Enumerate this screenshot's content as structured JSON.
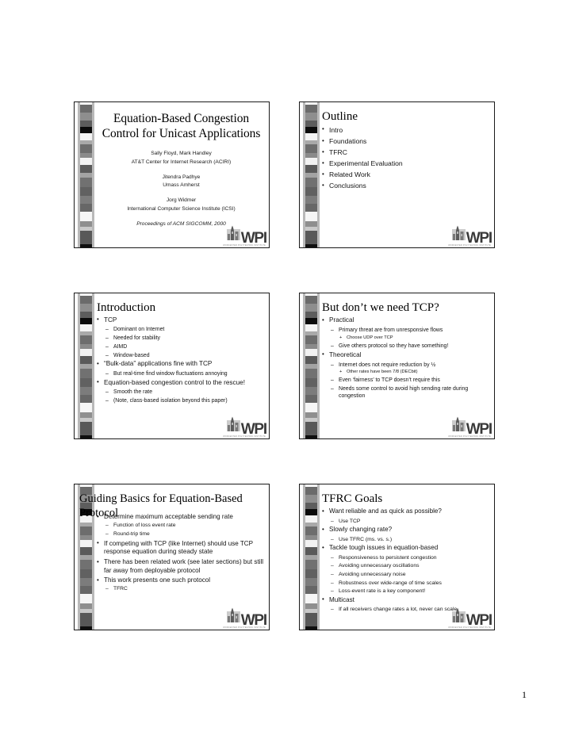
{
  "document": {
    "page_number": "1",
    "logo": {
      "mark": "WPI",
      "tagline": "WORCESTER POLYTECHNIC INSTITUTE",
      "icon": "wpi-tower-icon"
    }
  },
  "slides": [
    {
      "id": "slide-title",
      "title_line1": "Equation-Based Congestion",
      "title_line2": "Control for Unicast Applications",
      "authors": [
        {
          "name": "Sally Floyd, Mark Handley",
          "affiliation": "AT&T Center for Internet Research (ACIRI)"
        },
        {
          "name": "Jitendra Padhye",
          "affiliation": "Umass Amherst"
        },
        {
          "name": "Jorg Widmer",
          "affiliation": "International Computer Science Institute (ICSI)"
        }
      ],
      "proceedings": "Proceedings of ACM SIGCOMM, 2000"
    },
    {
      "id": "slide-outline",
      "title": "Outline",
      "bullets": [
        {
          "level": 1,
          "text": "Intro"
        },
        {
          "level": 1,
          "text": "Foundations"
        },
        {
          "level": 1,
          "text": "TFRC"
        },
        {
          "level": 1,
          "text": "Experimental Evaluation"
        },
        {
          "level": 1,
          "text": "Related Work"
        },
        {
          "level": 1,
          "text": "Conclusions"
        }
      ]
    },
    {
      "id": "slide-introduction",
      "title": "Introduction",
      "bullets": [
        {
          "level": 1,
          "text": "TCP"
        },
        {
          "level": 2,
          "text": "Dominant on Internet"
        },
        {
          "level": 2,
          "text": "Needed for stability"
        },
        {
          "level": 2,
          "text": "AIMD"
        },
        {
          "level": 2,
          "text": "Window-based"
        },
        {
          "level": 1,
          "text": "“Bulk-data” applications fine with TCP"
        },
        {
          "level": 2,
          "text": "But real-time find window fluctuations annoying"
        },
        {
          "level": 1,
          "text": "Equation-based congestion control to the rescue!"
        },
        {
          "level": 2,
          "text": "Smooth the rate"
        },
        {
          "level": 2,
          "text": "(Note, class-based isolation beyond this paper)"
        }
      ]
    },
    {
      "id": "slide-need-tcp",
      "title": "But don’t we need TCP?",
      "bullets": [
        {
          "level": 1,
          "text": "Practical"
        },
        {
          "level": 2,
          "text": "Primary threat are from unresponsive flows"
        },
        {
          "level": 3,
          "text": "Choose UDP over TCP"
        },
        {
          "level": 2,
          "text": "Give others protocol so they have something!"
        },
        {
          "level": 1,
          "text": "Theoretical"
        },
        {
          "level": 2,
          "text": "Internet does not require reduction by ½"
        },
        {
          "level": 3,
          "text": "Other rates have been 7/8 (DECbit)"
        },
        {
          "level": 2,
          "text": "Even ‘fairness’ to TCP doesn’t require this"
        },
        {
          "level": 2,
          "text": "Needs some control to avoid high sending rate during congestion"
        }
      ]
    },
    {
      "id": "slide-guiding-basics",
      "title": "Guiding Basics for Equation-Based Protocol",
      "bullets": [
        {
          "level": 1,
          "text": "Determine maximum acceptable sending rate"
        },
        {
          "level": 2,
          "text": "Function of loss event rate"
        },
        {
          "level": 2,
          "text": "Round-trip time"
        },
        {
          "level": 1,
          "text": "If competing with TCP (like Internet) should use TCP response equation during steady state"
        },
        {
          "level": 1,
          "text": "There has been related work (see later sections) but still far away from deployable protocol"
        },
        {
          "level": 1,
          "text": "This work presents one such protocol"
        },
        {
          "level": 2,
          "text": "TFRC"
        }
      ]
    },
    {
      "id": "slide-tfrc-goals",
      "title": "TFRC Goals",
      "bullets": [
        {
          "level": 1,
          "text": "Want reliable and as quick as possible?"
        },
        {
          "level": 2,
          "text": "Use TCP"
        },
        {
          "level": 1,
          "text": "Slowly changing rate?"
        },
        {
          "level": 2,
          "text": "Use TFRC (ms. vs. s.)"
        },
        {
          "level": 1,
          "text": "Tackle tough issues in equation-based"
        },
        {
          "level": 2,
          "text": "Responsiveness to persistent congestion"
        },
        {
          "level": 2,
          "text": "Avoiding unnecessary oscillations"
        },
        {
          "level": 2,
          "text": "Avoiding unnecessary noise"
        },
        {
          "level": 2,
          "text": "Robustness over wide-range of time scales"
        },
        {
          "level": 2,
          "text": "Loss-event rate is a key component!"
        },
        {
          "level": 1,
          "text": "Multicast"
        },
        {
          "level": 2,
          "text": "If all receivers change rates a lot, never can scale"
        }
      ]
    }
  ],
  "decor": {
    "strip_blocks": [
      {
        "color": "#ffffff",
        "h": 3
      },
      {
        "color": "#6b6b6b",
        "h": 11
      },
      {
        "color": "#8e8e8e",
        "h": 10
      },
      {
        "color": "#5d5d5d",
        "h": 9
      },
      {
        "color": "#0b0b0b",
        "h": 8
      },
      {
        "color": "#f4f4f4",
        "h": 10
      },
      {
        "color": "#a9a9a9",
        "h": 5
      },
      {
        "color": "#6d6d6d",
        "h": 12
      },
      {
        "color": "#8a8a8a",
        "h": 6
      },
      {
        "color": "#f2f2f2",
        "h": 9
      },
      {
        "color": "#5a5a5a",
        "h": 11
      },
      {
        "color": "#a3a3a3",
        "h": 6
      },
      {
        "color": "#717171",
        "h": 13
      },
      {
        "color": "#616161",
        "h": 12
      },
      {
        "color": "#7c7c7c",
        "h": 10
      },
      {
        "color": "#676767",
        "h": 11
      },
      {
        "color": "#f6f6f6",
        "h": 12
      },
      {
        "color": "#8f8f8f",
        "h": 8
      },
      {
        "color": "#c9c9c9",
        "h": 5
      },
      {
        "color": "#585858",
        "h": 18
      },
      {
        "color": "#101010",
        "h": 6
      }
    ]
  }
}
